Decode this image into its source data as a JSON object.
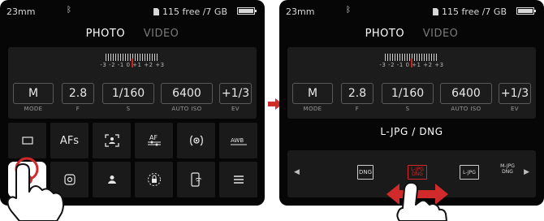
{
  "left_screen": {
    "status": {
      "focal_length": "23mm",
      "bluetooth_icon": "bluetooth-icon",
      "storage": "115 free /7 GB",
      "battery_icon": "battery-icon"
    },
    "modes": {
      "photo": "PHOTO",
      "video": "VIDEO",
      "active": "PHOTO"
    },
    "exposure_scale": {
      "labels": "-3  -2  -1   0  +1  +2  +3"
    },
    "params": [
      {
        "value": "M",
        "label": "MODE"
      },
      {
        "value": "2.8",
        "label": "F"
      },
      {
        "value": "1/160",
        "label": "S"
      },
      {
        "value": "6400",
        "label": "AUTO ISO"
      },
      {
        "value": "+1/3",
        "label": "EV"
      }
    ],
    "menu_row1": [
      {
        "icon": "drive-mode-icon"
      },
      {
        "text": "AFs"
      },
      {
        "icon": "af-field-icon"
      },
      {
        "icon": "af-settings-icon",
        "text": "AF"
      },
      {
        "icon": "metering-icon"
      },
      {
        "icon": "white-balance-icon",
        "text": "AWB"
      }
    ],
    "menu_row2": [
      {
        "icon": "file-format-icon",
        "selected": true
      },
      {
        "icon": "info-profile-icon"
      },
      {
        "icon": "user-profile-icon"
      },
      {
        "icon": "lock-icon"
      },
      {
        "icon": "wifi-phone-icon"
      },
      {
        "icon": "menu-icon"
      }
    ]
  },
  "right_screen": {
    "status": {
      "focal_length": "23mm",
      "bluetooth_icon": "bluetooth-icon",
      "storage": "115 free /7 GB",
      "battery_icon": "battery-icon"
    },
    "modes": {
      "photo": "PHOTO",
      "video": "VIDEO",
      "active": "PHOTO"
    },
    "exposure_scale": {
      "labels": "-3  -2  -1   0  +1  +2  +3"
    },
    "params": [
      {
        "value": "M",
        "label": "MODE"
      },
      {
        "value": "2.8",
        "label": "F"
      },
      {
        "value": "1/160",
        "label": "S"
      },
      {
        "value": "6400",
        "label": "AUTO ISO"
      },
      {
        "value": "+1/3",
        "label": "EV"
      }
    ],
    "format_title": "L-JPG / DNG",
    "format_options": [
      {
        "label": "DNG",
        "active": false
      },
      {
        "label": "L-JPG DNG",
        "active": true
      },
      {
        "label": "L-JPG",
        "active": false
      },
      {
        "label": "M-JPG DNG",
        "active": false
      }
    ]
  },
  "colors": {
    "accent": "#d12a2a",
    "screen_bg": "#060606",
    "panel_bg": "#1c1c1c"
  },
  "annotations": {
    "transition_arrow": "arrow-right-icon",
    "swipe_arrow": "double-arrow-icon",
    "tap_hand": "hand-pointer-icon"
  }
}
